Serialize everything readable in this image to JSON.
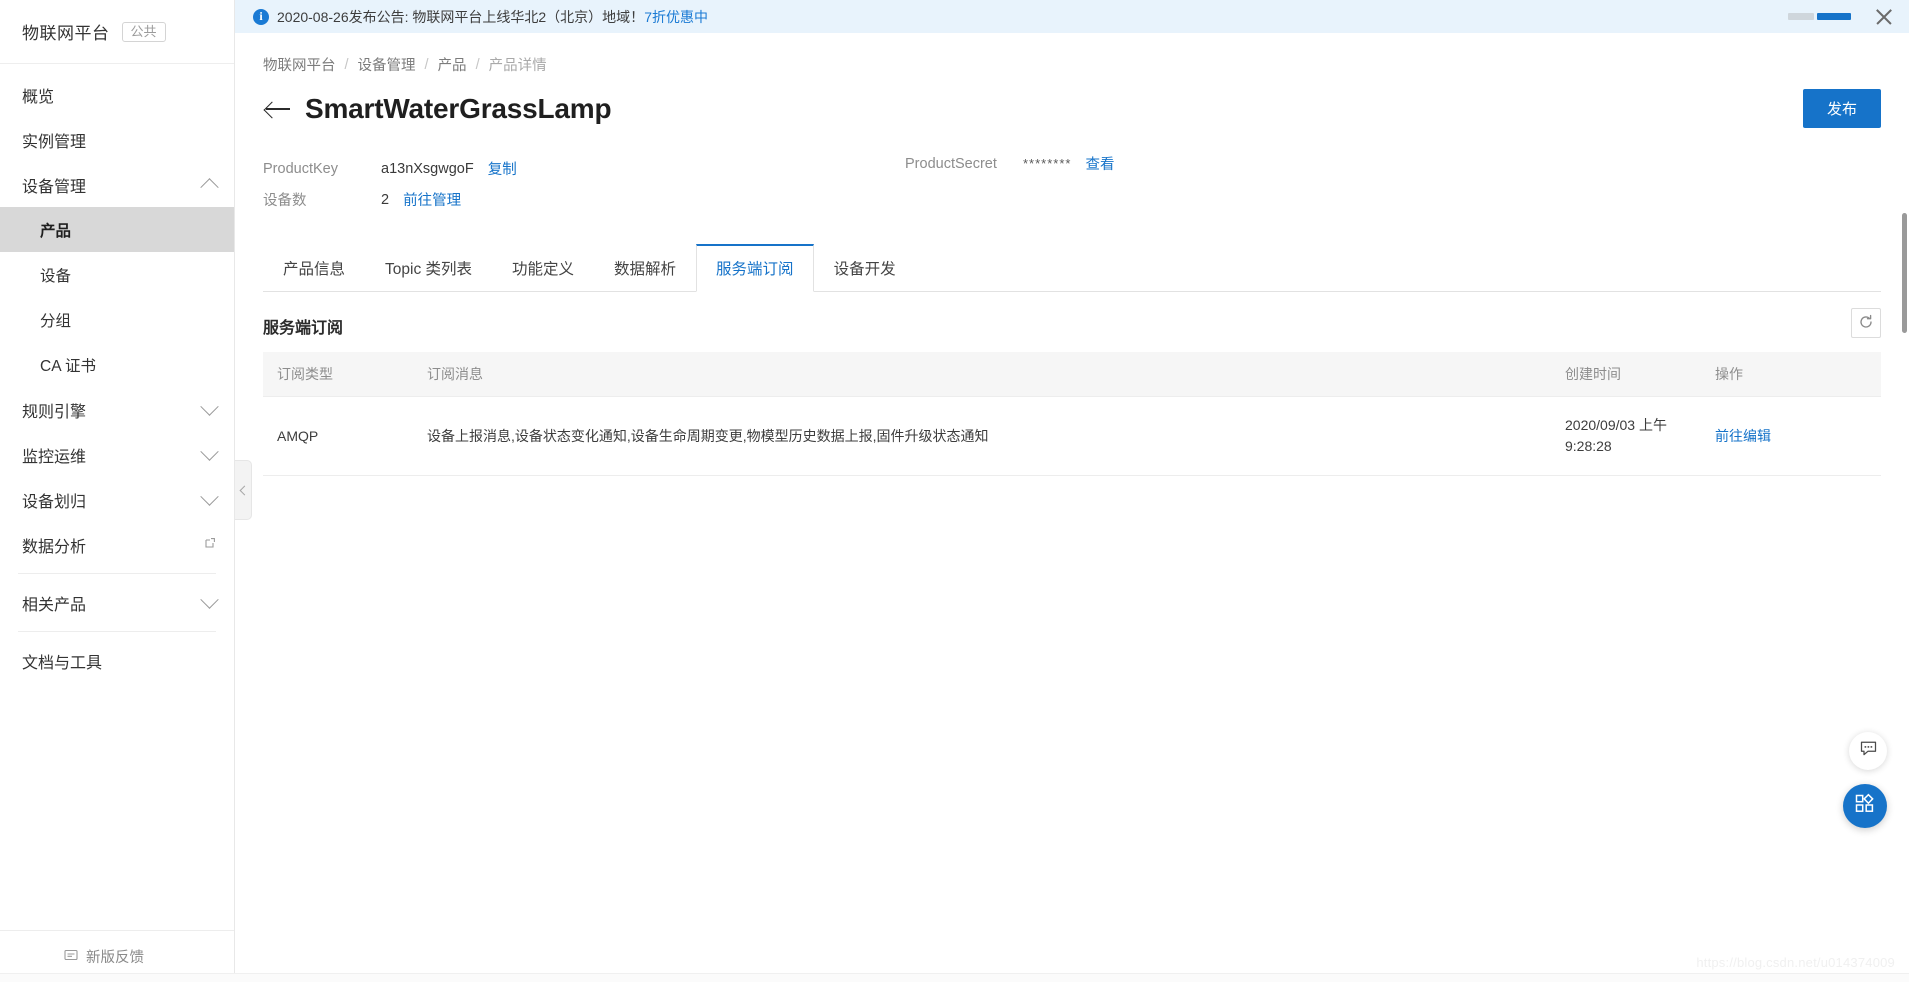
{
  "colors": {
    "accent": "#1673c9",
    "banner_bg": "#e8f3fc",
    "active_item_bg": "#d8d8d8"
  },
  "sidebar": {
    "brand": {
      "title": "物联网平台",
      "tag": "公共"
    },
    "items": [
      {
        "label": "概览",
        "icon": "",
        "level": 0,
        "state": ""
      },
      {
        "label": "实例管理",
        "icon": "",
        "level": 0,
        "state": ""
      },
      {
        "label": "设备管理",
        "icon": "chevron-up-icon",
        "level": 0,
        "state": "expanded"
      },
      {
        "label": "产品",
        "icon": "",
        "level": 1,
        "state": "active"
      },
      {
        "label": "设备",
        "icon": "",
        "level": 1,
        "state": ""
      },
      {
        "label": "分组",
        "icon": "",
        "level": 1,
        "state": ""
      },
      {
        "label": "CA 证书",
        "icon": "",
        "level": 1,
        "state": ""
      },
      {
        "label": "规则引擎",
        "icon": "chevron-down-icon",
        "level": 0,
        "state": "collapsed"
      },
      {
        "label": "监控运维",
        "icon": "chevron-down-icon",
        "level": 0,
        "state": "collapsed"
      },
      {
        "label": "设备划归",
        "icon": "chevron-down-icon",
        "level": 0,
        "state": "collapsed"
      },
      {
        "label": "数据分析",
        "icon": "external-link-icon",
        "level": 0,
        "state": ""
      },
      {
        "label": "相关产品",
        "icon": "chevron-down-icon",
        "level": 0,
        "state": "collapsed"
      },
      {
        "label": "文档与工具",
        "icon": "",
        "level": 0,
        "state": ""
      }
    ],
    "footer": {
      "label": "新版反馈",
      "icon": "feedback-icon"
    }
  },
  "banner": {
    "icon": "info-icon",
    "text": "2020-08-26发布公告: 物联网平台上线华北2（北京）地域！",
    "link": "7折优惠中",
    "close_icon": "close-icon"
  },
  "breadcrumb": [
    "物联网平台",
    "设备管理",
    "产品",
    "产品详情"
  ],
  "header": {
    "back_icon": "back-arrow-icon",
    "title": "SmartWaterGrassLamp",
    "publish_label": "发布"
  },
  "meta": {
    "product_key_label": "ProductKey",
    "product_key_value": "a13nXsgwgoF",
    "copy_label": "复制",
    "device_count_label": "设备数",
    "device_count_value": "2",
    "manage_label": "前往管理",
    "product_secret_label": "ProductSecret",
    "product_secret_value": "********",
    "view_label": "查看"
  },
  "tabs": [
    {
      "label": "产品信息",
      "active": false
    },
    {
      "label": "Topic 类列表",
      "active": false
    },
    {
      "label": "功能定义",
      "active": false
    },
    {
      "label": "数据解析",
      "active": false
    },
    {
      "label": "服务端订阅",
      "active": true
    },
    {
      "label": "设备开发",
      "active": false
    }
  ],
  "panel": {
    "title": "服务端订阅",
    "refresh_icon": "refresh-icon",
    "columns": [
      "订阅类型",
      "订阅消息",
      "创建时间",
      "操作"
    ],
    "rows": [
      {
        "type": "AMQP",
        "message": "设备上报消息,设备状态变化通知,设备生命周期变更,物模型历史数据上报,固件升级状态通知",
        "time_line1": "2020/09/03 上午",
        "time_line2": "9:28:28",
        "action": "前往编辑"
      }
    ]
  },
  "collapse_handle": {
    "icon": "chevron-left-icon"
  },
  "float_buttons": [
    {
      "name": "chat-button",
      "icon": "chat-bubble-icon"
    },
    {
      "name": "apps-button",
      "icon": "apps-grid-icon"
    }
  ],
  "watermark": "https://blog.csdn.net/u014374009"
}
